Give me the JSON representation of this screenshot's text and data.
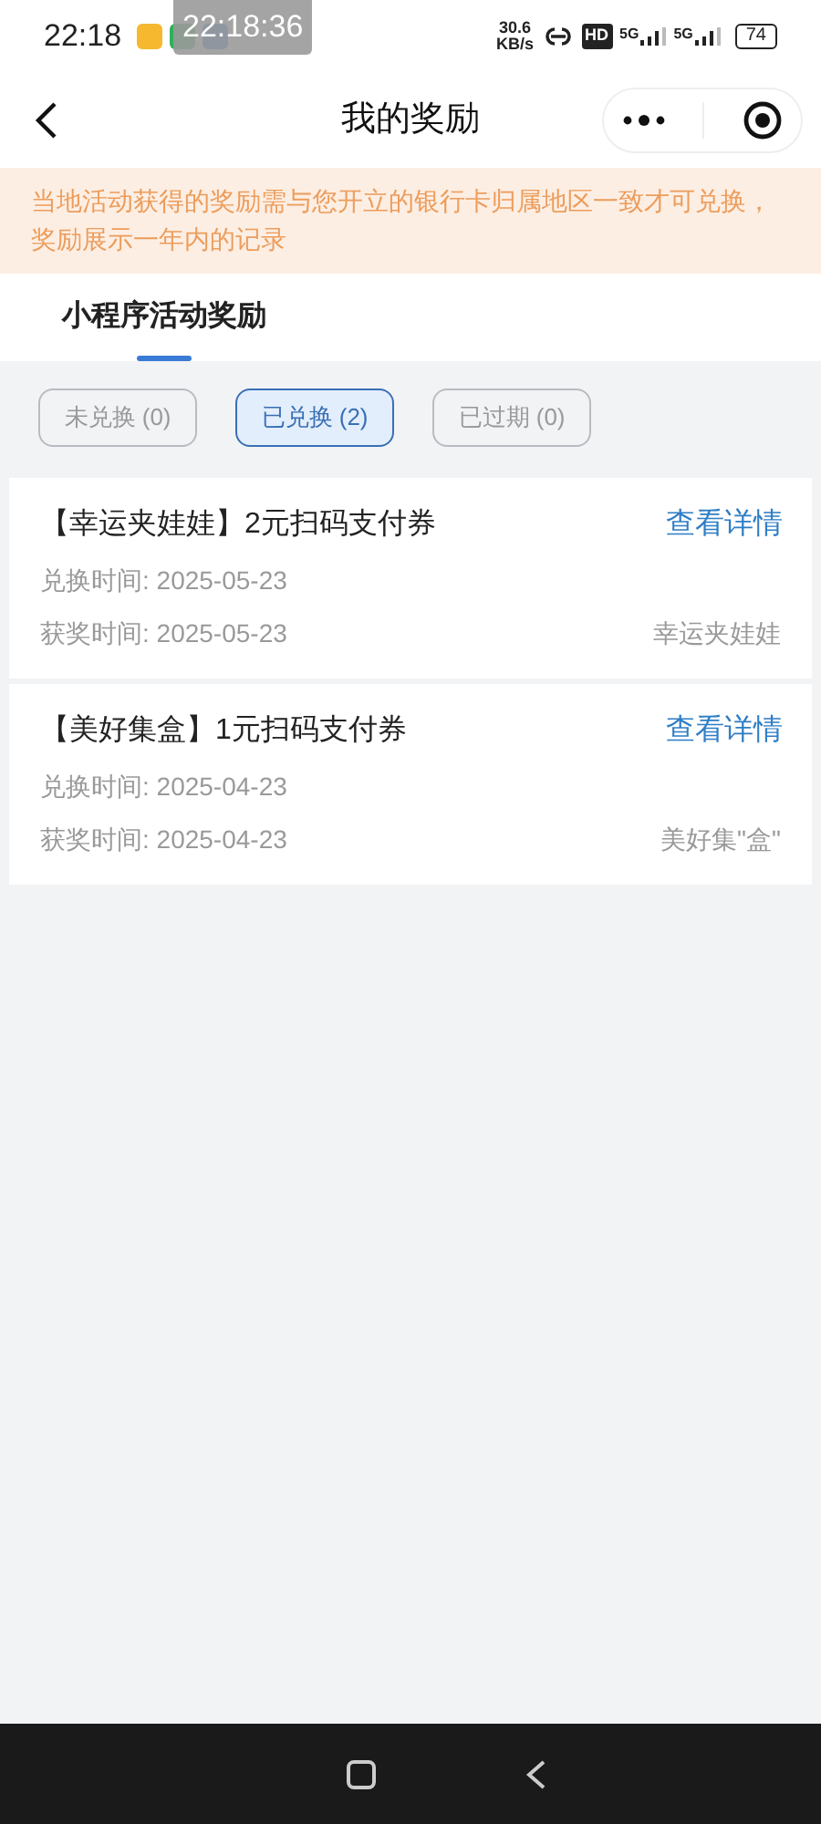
{
  "status_bar": {
    "time": "22:18",
    "clock_overlay": "22:18:36",
    "speed_value": "30.6",
    "speed_unit": "KB/s",
    "hd": "HD",
    "networks": [
      "5G",
      "5G"
    ],
    "battery": "74"
  },
  "header": {
    "title": "我的奖励"
  },
  "notice": "当地活动获得的奖励需与您开立的银行卡归属地区一致才可兑换，奖励展示一年内的记录",
  "tabs": [
    {
      "label": "小程序活动奖励",
      "selected": true
    }
  ],
  "filters": [
    {
      "label": "未兑换 (0)",
      "selected": false
    },
    {
      "label": "已兑换 (2)",
      "selected": true
    },
    {
      "label": "已过期 (0)",
      "selected": false
    }
  ],
  "rewards": [
    {
      "title": "【幸运夹娃娃】2元扫码支付券",
      "link": "查看详情",
      "redeem_time": "兑换时间: 2025-05-23",
      "award_time": "获奖时间: 2025-05-23",
      "source": "幸运夹娃娃"
    },
    {
      "title": "【美好集盒】1元扫码支付券",
      "link": "查看详情",
      "redeem_time": "兑换时间: 2025-04-23",
      "award_time": "获奖时间: 2025-04-23",
      "source": "美好集\"盒\""
    }
  ]
}
